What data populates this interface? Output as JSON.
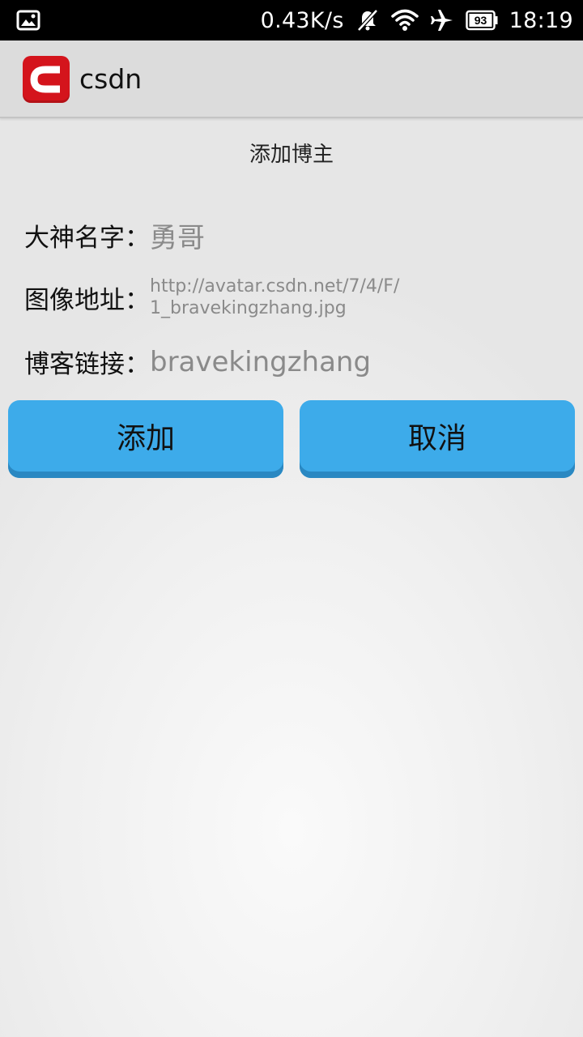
{
  "status_bar": {
    "network_speed": "0.43K/s",
    "battery_level": "93",
    "time": "18:19",
    "icons": [
      "image-icon",
      "notifications-off-icon",
      "wifi-icon",
      "airplane-icon",
      "battery-icon"
    ]
  },
  "app_bar": {
    "title": "csdn",
    "logo_color": "#d4141c"
  },
  "dialog": {
    "title": "添加博主",
    "fields": {
      "name_label": "大神名字：",
      "name_value": "勇哥",
      "avatar_label": "图像地址：",
      "avatar_value": "http://avatar.csdn.net/7/4/F/1_bravekingzhang.jpg",
      "blog_label": "博客链接：",
      "blog_value": "bravekingzhang"
    },
    "buttons": {
      "add_label": "添加",
      "cancel_label": "取消",
      "color": "#3dabea"
    }
  }
}
